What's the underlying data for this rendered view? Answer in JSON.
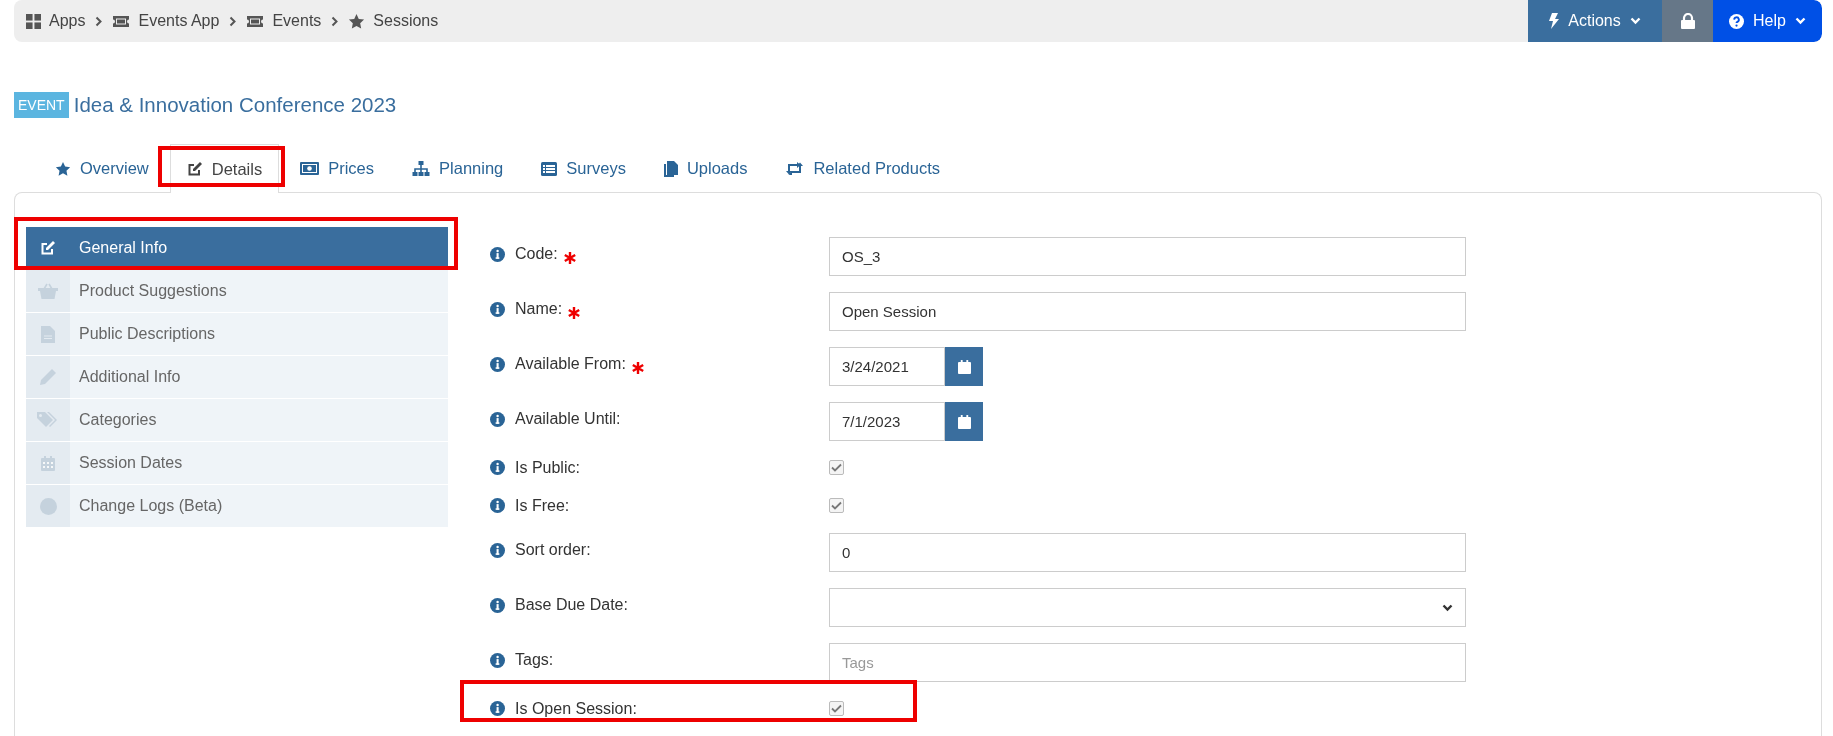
{
  "breadcrumb": [
    {
      "label": "Apps"
    },
    {
      "label": "Events App"
    },
    {
      "label": "Events"
    },
    {
      "label": "Sessions"
    }
  ],
  "toolbar": {
    "actions": "Actions",
    "help": "Help"
  },
  "header": {
    "badge": "EVENT",
    "title": "Idea & Innovation Conference 2023"
  },
  "tabs": [
    {
      "label": "Overview",
      "selected": false,
      "highlighted": false
    },
    {
      "label": "Details",
      "selected": true,
      "highlighted": true
    },
    {
      "label": "Prices",
      "selected": false,
      "highlighted": false
    },
    {
      "label": "Planning",
      "selected": false,
      "highlighted": false
    },
    {
      "label": "Surveys",
      "selected": false,
      "highlighted": false
    },
    {
      "label": "Uploads",
      "selected": false,
      "highlighted": false
    },
    {
      "label": "Related Products",
      "selected": false,
      "highlighted": false
    }
  ],
  "sidebar": {
    "items": [
      {
        "label": "General Info",
        "selected": true,
        "highlighted": true
      },
      {
        "label": "Product Suggestions",
        "selected": false,
        "highlighted": false
      },
      {
        "label": "Public Descriptions",
        "selected": false,
        "highlighted": false
      },
      {
        "label": "Additional Info",
        "selected": false,
        "highlighted": false
      },
      {
        "label": "Categories",
        "selected": false,
        "highlighted": false
      },
      {
        "label": "Session Dates",
        "selected": false,
        "highlighted": false
      },
      {
        "label": "Change Logs (Beta)",
        "selected": false,
        "highlighted": false
      }
    ]
  },
  "form": {
    "fields": [
      {
        "kind": "text",
        "label": "Code:",
        "required": true,
        "value": "OS_3",
        "highlighted": false
      },
      {
        "kind": "text",
        "label": "Name:",
        "required": true,
        "value": "Open Session",
        "highlighted": false
      },
      {
        "kind": "date",
        "label": "Available From:",
        "required": true,
        "value": "3/24/2021",
        "highlighted": false
      },
      {
        "kind": "date",
        "label": "Available Until:",
        "required": false,
        "value": "7/1/2023",
        "highlighted": false
      },
      {
        "kind": "checkbox",
        "label": "Is Public:",
        "required": false,
        "checked": true,
        "highlighted": false
      },
      {
        "kind": "checkbox",
        "label": "Is Free:",
        "required": false,
        "checked": true,
        "highlighted": false
      },
      {
        "kind": "text",
        "label": "Sort order:",
        "required": false,
        "value": "0",
        "highlighted": false
      },
      {
        "kind": "select",
        "label": "Base Due Date:",
        "required": false,
        "highlighted": false
      },
      {
        "kind": "tags",
        "label": "Tags:",
        "required": false,
        "placeholder": "Tags",
        "highlighted": false
      },
      {
        "kind": "checkbox",
        "label": "Is Open Session:",
        "required": false,
        "checked": true,
        "highlighted": true
      }
    ]
  }
}
